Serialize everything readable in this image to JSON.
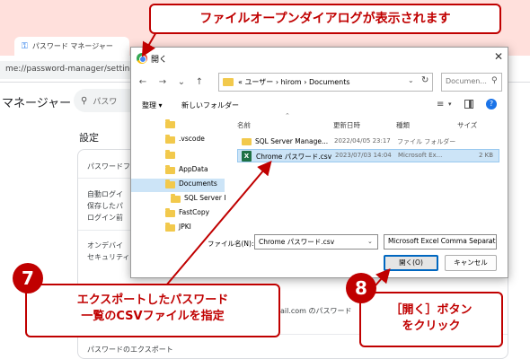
{
  "browser": {
    "tab_title": "パスワード マネージャー",
    "url": "me://password-manager/settings"
  },
  "app": {
    "title": "マネージャー",
    "search_placeholder": "パスワ",
    "settings_heading": "設定",
    "rows": [
      "パスワードフ",
      "自動ログイ",
      "保存したパ",
      "ログイン前",
      "オンデバイ",
      "セキュリティ",
      "ail.com のパスワード",
      "パスワードのエクスポート"
    ]
  },
  "dialog": {
    "title": "開く",
    "path": "« ユーザー  ›  hirom  ›  Documents",
    "search_placeholder": "Documen...",
    "organize": "整理 ▾",
    "new_folder": "新しいフォルダー",
    "nav_items": [
      {
        "label": "",
        "indent": 0
      },
      {
        "label": ".vscode",
        "indent": 0
      },
      {
        "label": "",
        "indent": 0
      },
      {
        "label": "AppData",
        "indent": 0
      },
      {
        "label": "Documents",
        "indent": 0,
        "selected": true
      },
      {
        "label": "SQL Server I",
        "indent": 1
      },
      {
        "label": "FastCopy",
        "indent": 0
      },
      {
        "label": "JPKI",
        "indent": 0
      }
    ],
    "columns": [
      "名前",
      "更新日時",
      "種類",
      "サイズ"
    ],
    "files": [
      {
        "name": "SQL Server Manage...",
        "date": "2022/04/05 23:17",
        "type": "ファイル フォルダー",
        "size": "",
        "kind": "folder"
      },
      {
        "name": "Chrome パスワード.csv",
        "date": "2023/07/03 14:04",
        "type": "Microsoft Ex...",
        "size": "2 KB",
        "kind": "excel",
        "selected": true
      }
    ],
    "filename_label": "ファイル名(N):",
    "filename_value": "Chrome パスワード.csv",
    "filter_value": "Microsoft Excel Comma Separat",
    "open_button": "開く(O)",
    "cancel_button": "キャンセル"
  },
  "callouts": {
    "top": "ファイルオープンダイアログが表示されます",
    "step7_number": "7",
    "step7_line1": "エクスポートしたパスワード",
    "step7_line2": "一覧のCSVファイルを指定",
    "step8_number": "8",
    "step8_line1": "［開く］ボタン",
    "step8_line2": "をクリック"
  },
  "colors": {
    "callout_red": "#c00000",
    "selection_blue": "#cce4f7",
    "tabbar_pink": "#ffe0dc"
  }
}
